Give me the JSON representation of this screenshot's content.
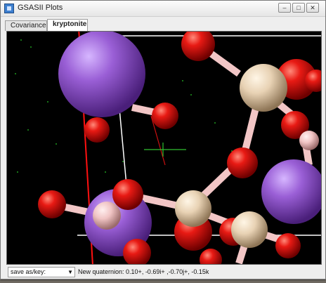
{
  "window": {
    "title": "GSASII Plots"
  },
  "tabs": [
    {
      "label": "Covariance",
      "active": false
    },
    {
      "label": "kryptonite",
      "active": true
    }
  ],
  "viewer": {
    "background": "#000000",
    "atom_colors": {
      "red": "#e01010",
      "purple": "#9a5fd6",
      "beige": "#e8d2b4",
      "pink": "#f2c6c6"
    }
  },
  "footer": {
    "select_value": "save as/key:",
    "status": "New quaternion: 0.10+, -0.69i+ ,-0.70j+, -0.15k"
  }
}
